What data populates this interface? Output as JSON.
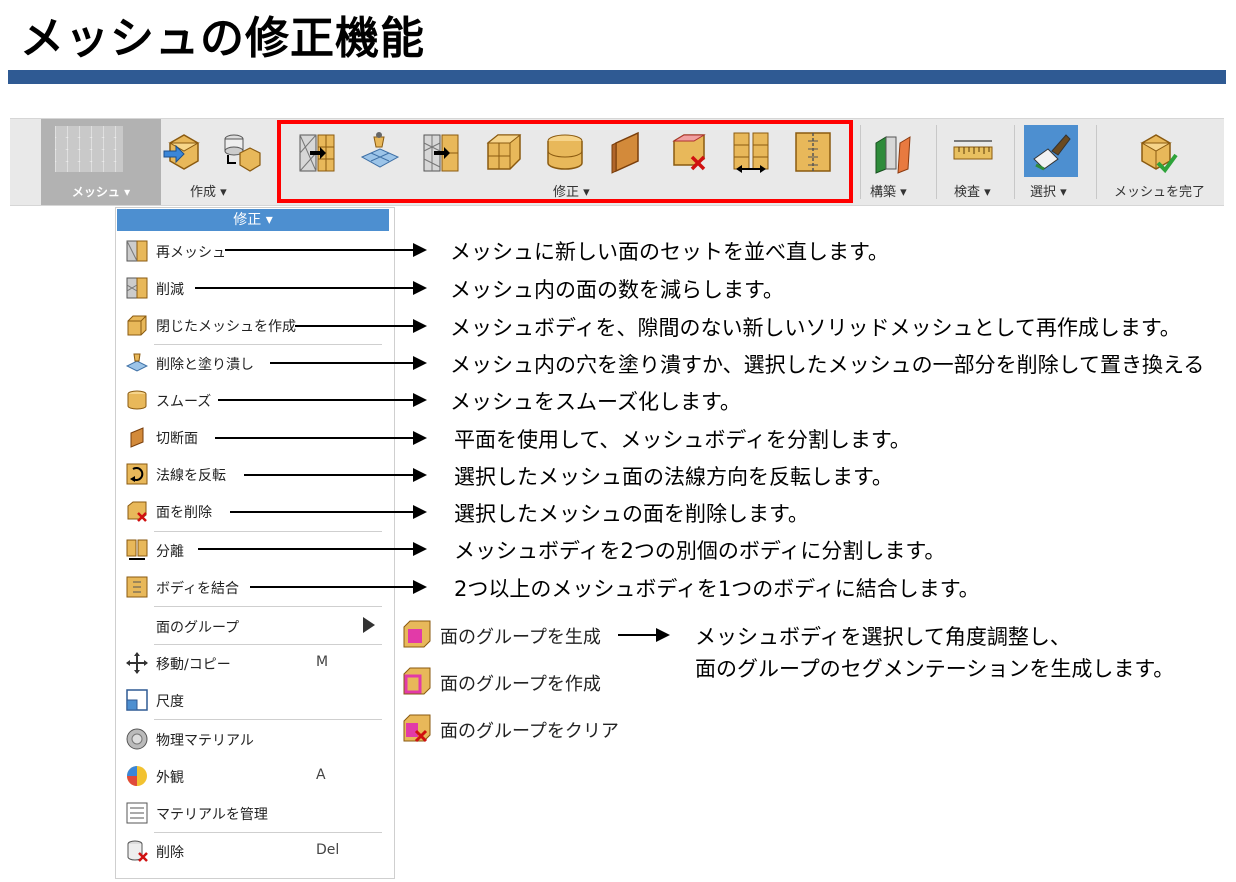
{
  "title": "メッシュの修正機能",
  "ribbon": {
    "mesh_tab": "メッシュ ▾",
    "groups": {
      "create": "作成 ▾",
      "modify": "修正 ▾",
      "assemble": "構築 ▾",
      "inspect": "検査 ▾",
      "select": "選択 ▾",
      "finish": "メッシュを完了"
    }
  },
  "menu": {
    "header": "修正 ▾",
    "items": [
      {
        "label": "再メッシュ",
        "icon": "remesh-icon"
      },
      {
        "label": "削減",
        "icon": "reduce-icon"
      },
      {
        "label": "閉じたメッシュを作成",
        "icon": "make-closed-mesh-icon"
      },
      {
        "label": "削除と塗り潰し",
        "icon": "erase-and-fill-icon"
      },
      {
        "label": "スムーズ",
        "icon": "smooth-icon"
      },
      {
        "label": "切断面",
        "icon": "plane-cut-icon"
      },
      {
        "label": "法線を反転",
        "icon": "reverse-normal-icon"
      },
      {
        "label": "面を削除",
        "icon": "delete-faces-icon"
      },
      {
        "label": "分離",
        "icon": "separate-icon"
      },
      {
        "label": "ボディを結合",
        "icon": "combine-bodies-icon"
      },
      {
        "label": "面のグループ",
        "icon": ""
      },
      {
        "label": "移動/コピー",
        "key": "M",
        "icon": "move-copy-icon"
      },
      {
        "label": "尺度",
        "icon": "scale-icon"
      },
      {
        "label": "物理マテリアル",
        "icon": "physical-material-icon"
      },
      {
        "label": "外観",
        "key": "A",
        "icon": "appearance-icon"
      },
      {
        "label": "マテリアルを管理",
        "icon": "manage-materials-icon"
      },
      {
        "label": "削除",
        "key": "Del",
        "icon": "delete-icon"
      }
    ]
  },
  "descriptions": [
    "メッシュに新しい面のセットを並べ直します。",
    "メッシュ内の面の数を減らします。",
    "メッシュボディを、隙間のない新しいソリッドメッシュとして再作成します。",
    "メッシュ内の穴を塗り潰すか、選択したメッシュの一部分を削除して置き換える",
    "メッシュをスムーズ化します。",
    "平面を使用して、メッシュボディを分割します。",
    "選択したメッシュ面の法線方向を反転します。",
    "選択したメッシュの面を削除します。",
    "メッシュボディを2つの別個のボディに分割します。",
    "2つ以上のメッシュボディを1つのボディに結合します。"
  ],
  "face_groups": {
    "items": [
      "面のグループを生成",
      "面のグループを作成",
      "面のグループをクリア"
    ],
    "description_line1": "メッシュボディを選択して角度調整し、",
    "description_line2": "面のグループのセグメンテーションを生成します。"
  },
  "colors": {
    "title_bar": "#2f5a93",
    "highlight_frame": "#ff0000",
    "menu_header": "#4d8fd0",
    "mesh_tab": "#b2b2b2"
  }
}
